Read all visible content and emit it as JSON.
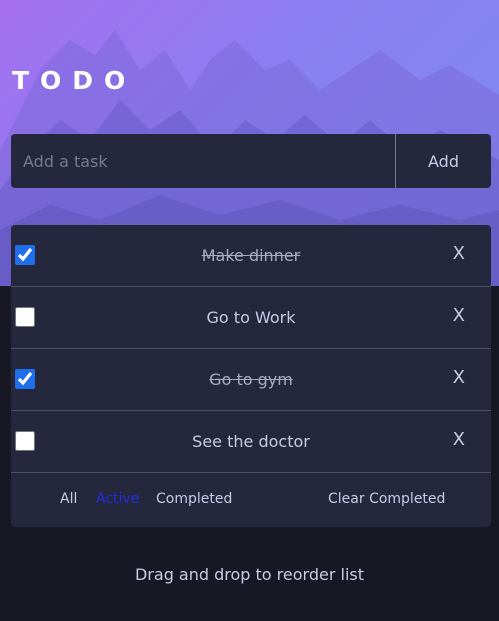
{
  "app": {
    "title": "TODO"
  },
  "new_task": {
    "placeholder": "Add a task",
    "add_label": "Add"
  },
  "todos": [
    {
      "text": "Make dinner",
      "completed": true,
      "delete_label": "X"
    },
    {
      "text": "Go to Work",
      "completed": false,
      "delete_label": "X"
    },
    {
      "text": "Go to gym",
      "completed": true,
      "delete_label": "X"
    },
    {
      "text": "See the doctor",
      "completed": false,
      "delete_label": "X"
    }
  ],
  "filters": {
    "all": "All",
    "active": "Active",
    "completed": "Completed",
    "clear": "Clear Completed",
    "selected": "active"
  },
  "hint": "Drag and drop to reorder list",
  "colors": {
    "background": "#181824",
    "card": "#25273c",
    "accent": "#1f2de6",
    "checkbox": "#1f6feb"
  }
}
